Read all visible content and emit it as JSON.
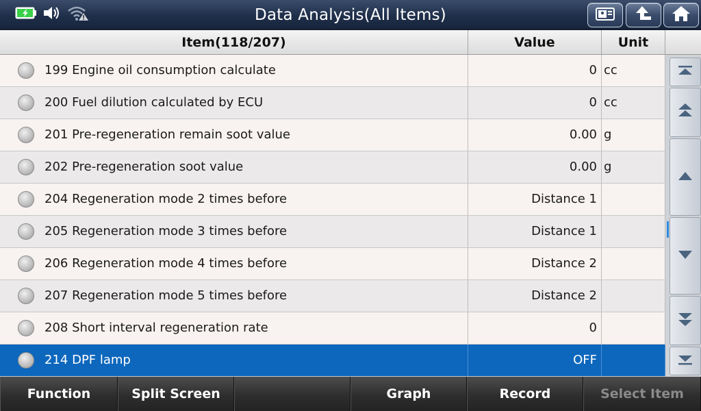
{
  "titlebar": {
    "title": "Data Analysis(All Items)",
    "status_icons": [
      "battery-charging-icon",
      "speaker-icon",
      "wifi-warning-icon"
    ],
    "buttons": [
      "screenshot-icon",
      "back-arrow-icon",
      "home-icon"
    ]
  },
  "table": {
    "headers": {
      "item": "Item(118/207)",
      "value": "Value",
      "unit": "Unit"
    },
    "rows": [
      {
        "item": "199 Engine oil consumption calculate",
        "value": "0",
        "unit": "cc"
      },
      {
        "item": "200 Fuel dilution calculated by ECU",
        "value": "0",
        "unit": "cc"
      },
      {
        "item": "201 Pre-regeneration remain soot value",
        "value": "0.00",
        "unit": "g"
      },
      {
        "item": "202 Pre-regeneration soot value",
        "value": "0.00",
        "unit": "g"
      },
      {
        "item": "204 Regeneration mode 2 times before",
        "value": "Distance 1",
        "unit": ""
      },
      {
        "item": "205 Regeneration mode 3 times before",
        "value": "Distance 1",
        "unit": ""
      },
      {
        "item": "206 Regeneration mode 4 times before",
        "value": "Distance 2",
        "unit": ""
      },
      {
        "item": "207 Regeneration mode 5 times before",
        "value": "Distance 2",
        "unit": ""
      },
      {
        "item": "208 Short interval regeneration rate",
        "value": "0",
        "unit": ""
      },
      {
        "item": "214 DPF lamp",
        "value": "OFF",
        "unit": ""
      }
    ],
    "selected_row": 9
  },
  "scroll": {
    "buttons": [
      "scroll-top-icon",
      "page-up-icon",
      "line-up-icon",
      "line-down-icon",
      "page-down-icon",
      "scroll-bottom-icon"
    ]
  },
  "bottombar": {
    "function": "Function",
    "split_screen": "Split Screen",
    "empty": "",
    "graph": "Graph",
    "record": "Record",
    "select_item": "Select Item"
  },
  "colors": {
    "selected_row": "#0d67bd",
    "titlebar": "#1f2f4a",
    "battery": "#3ad04a"
  }
}
